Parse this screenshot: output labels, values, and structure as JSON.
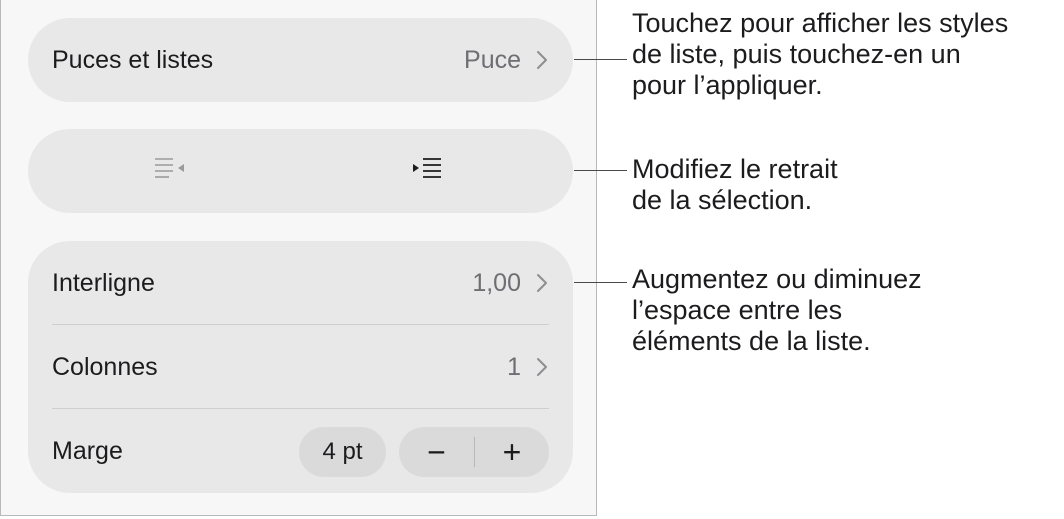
{
  "bullets": {
    "label": "Puces et listes",
    "value": "Puce"
  },
  "indent": {
    "decrease_icon": "decrease-indent-icon",
    "increase_icon": "increase-indent-icon"
  },
  "spacing": {
    "label": "Interligne",
    "value": "1,00"
  },
  "columns": {
    "label": "Colonnes",
    "value": "1"
  },
  "margin": {
    "label": "Marge",
    "value": "4 pt",
    "minus": "−",
    "plus": "+"
  },
  "callouts": {
    "bullets": [
      "Touchez pour afficher les styles",
      "de liste, puis touchez-en un",
      "pour l’appliquer."
    ],
    "indent": [
      "Modifiez le retrait",
      "de la sélection."
    ],
    "spacing": [
      "Augmentez ou diminuez",
      "l’espace entre les",
      "éléments de la liste."
    ]
  }
}
